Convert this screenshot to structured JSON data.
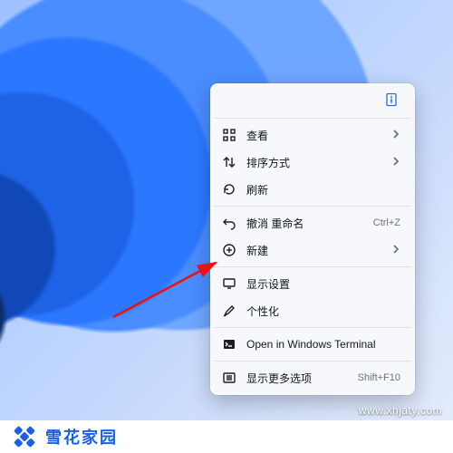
{
  "menu": {
    "items": [
      {
        "icon": "grid-icon",
        "label": "查看",
        "accel": "",
        "submenu": true
      },
      {
        "icon": "sort-icon",
        "label": "排序方式",
        "accel": "",
        "submenu": true
      },
      {
        "icon": "refresh-icon",
        "label": "刷新",
        "accel": "",
        "submenu": false
      },
      {
        "sep": true
      },
      {
        "icon": "undo-icon",
        "label": "撤消 重命名",
        "accel": "Ctrl+Z",
        "submenu": false
      },
      {
        "icon": "new-icon",
        "label": "新建",
        "accel": "",
        "submenu": true
      },
      {
        "sep": true
      },
      {
        "icon": "display-icon",
        "label": "显示设置",
        "accel": "",
        "submenu": false
      },
      {
        "icon": "brush-icon",
        "label": "个性化",
        "accel": "",
        "submenu": false
      },
      {
        "sep": true
      },
      {
        "icon": "terminal-icon",
        "label": "Open in Windows Terminal",
        "accel": "",
        "submenu": false
      },
      {
        "sep": true
      },
      {
        "icon": "more-icon",
        "label": "显示更多选项",
        "accel": "Shift+F10",
        "submenu": false
      }
    ]
  },
  "watermark": {
    "brand": "雪花家园",
    "url": "www.xhjaty.com"
  }
}
